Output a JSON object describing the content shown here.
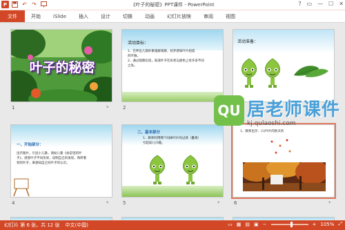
{
  "titlebar": {
    "title": "《叶子的秘密》PPT课件 - PowerPoint",
    "logo": "P",
    "quick_access": [
      "save-icon",
      "undo-icon",
      "redo-icon",
      "start-slideshow-icon"
    ],
    "window_buttons": [
      "?",
      "▭",
      "—",
      "☐",
      "✕"
    ]
  },
  "ribbon": {
    "tabs": [
      "文件",
      "开始",
      "iSlide",
      "插入",
      "设计",
      "切换",
      "动画",
      "幻灯片放映",
      "审阅",
      "视图"
    ]
  },
  "slides": [
    {
      "number": "1",
      "title": "叶子的秘密"
    },
    {
      "number": "2",
      "heading": "活动目标：",
      "lines": [
        "1、在伸出儿歌形象理解观察，初步感知叶片组成",
        "的叶脉。",
        "2、通过观察比较，知道叶子在形状与颜色上有许多不同",
        "之处。"
      ]
    },
    {
      "number": "3",
      "heading": "活动准备："
    },
    {
      "number": "4",
      "heading": "一、开始部分：",
      "lines": [
        "出示图片，引出小儿歌，请幼儿看《会说话的叶",
        "子》，感受叶子不同形状，说明自己的发现，和所看",
        "到的叶子，来感知自己对叶子的认识。"
      ]
    },
    {
      "number": "5",
      "heading": "二、基本部分",
      "lines": [
        "1、教师利用两个同样叶片的过渡（叠滑）",
        "引起幼儿兴趣。"
      ]
    },
    {
      "number": "6",
      "lines": [
        "1、教师出示：(1)叶片的秋天的"
      ]
    }
  ],
  "slide_stars": [
    "*",
    "*",
    "*",
    "*",
    "*",
    "*"
  ],
  "statusbar": {
    "slide_info": "幻灯片 第 6 张，共 12 张",
    "language": "中文(中国)",
    "zoom_minus": "−",
    "zoom_plus": "+",
    "zoom": "105%",
    "zoom_level_percent": 105
  },
  "watermark": {
    "badge": "QU",
    "text": "居老师课件",
    "url": "kj.qulaoshi.com"
  },
  "colors": {
    "accent": "#d24726",
    "sorter_bg": "#e9e9e9",
    "leaf": "#8cc63f"
  }
}
